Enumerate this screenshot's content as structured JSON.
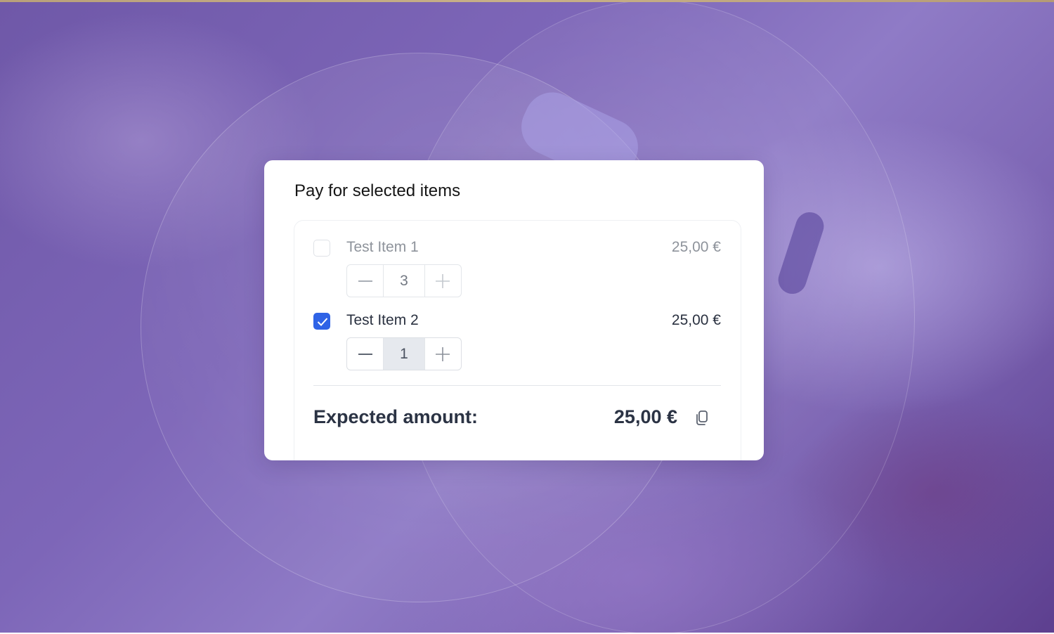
{
  "card": {
    "title": "Pay for selected items"
  },
  "items": [
    {
      "name": "Test Item 1",
      "price": "25,00 €",
      "quantity": "3",
      "checked": false,
      "decrement_icon": "minus-icon",
      "increment_icon": "plus-icon"
    },
    {
      "name": "Test Item 2",
      "price": "25,00 €",
      "quantity": "1",
      "checked": true,
      "decrement_icon": "minus-icon",
      "increment_icon": "plus-icon"
    }
  ],
  "summary": {
    "label": "Expected amount:",
    "amount": "25,00 €",
    "copy_icon": "copy-icon"
  },
  "colors": {
    "accent": "#2f63e6",
    "text_dark": "#2b3344",
    "text_muted": "#8e939b"
  }
}
